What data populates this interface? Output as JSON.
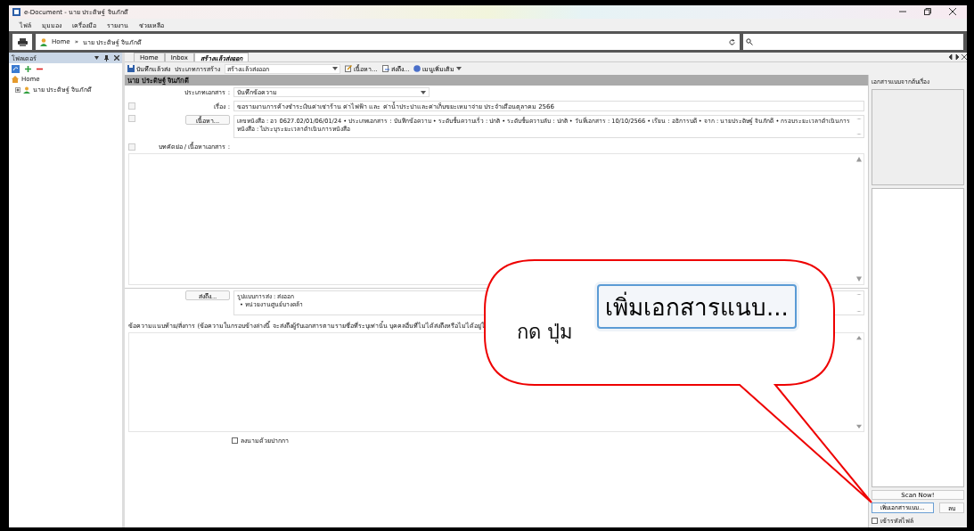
{
  "window": {
    "title": "e-Document - นาย ประดิษฐ์ จินภักดี"
  },
  "menu": [
    "ไฟล์",
    "มุมมอง",
    "เครื่องมือ",
    "รายงาน",
    "ช่วยเหลือ"
  ],
  "address": {
    "crumbs": [
      "Home",
      "»",
      "นาย ประดิษฐ์ จินภักดี"
    ]
  },
  "folder_panel": {
    "title": "โฟลเดอร์",
    "tree": [
      {
        "label": "Home",
        "children": [
          {
            "label": "นาย ประดิษฐ์ จินภักดี",
            "expanded": false
          }
        ]
      }
    ]
  },
  "tabs": [
    {
      "label": "Home",
      "selected": false
    },
    {
      "label": "Inbox",
      "selected": false
    },
    {
      "label": "สร้างแล้วส่งออก",
      "selected": true
    }
  ],
  "toolbar": {
    "save": "บันทึกแล้วส่ง",
    "create_type_label": "ประเภทการสร้าง",
    "create_type_value": "สร้างแล้วส่งออก",
    "content": "เนื้อหา...",
    "send_to": "ส่งถึง...",
    "more": "เมนูเพิ่มเติม"
  },
  "header": "นาย ประดิษฐ์ จินภักดี",
  "form": {
    "doc_type_label": "ประเภทเอกสาร :",
    "doc_type_value": "บันทึกข้อความ",
    "subject_label": "เรื่อง :",
    "subject_value": "ขอรายงานการค้างชำระเงินค่าเช่าร้าน ค่าไฟฟ้า และ ค่าน้ำประปาและค่าเก็บขยะเหมาจ่าย ประจำเดือนตุลาคม 2566",
    "content_button": "เนื้อหา...",
    "content_value": "เลขหนังสือ : อว 0627.02/01/06/01/24 • ประเภทเอกสาร : บันทึกข้อความ • ระดับชั้นความเร็ว : ปกติ • ระดับชั้นความลับ : ปกติ • วันที่เอกสาร : 10/10/2566 • เรียน : อธิการบดี • จาก : นายประดิษฐ์  จินภักดี • กรอบระยะเวลาดำเนินการหนังสือ : ไม่ระบุระยะเวลาดำเนินการหนังสือ",
    "abstract_label": "บทคัดย่อ / เนื้อหาเอกสาร :",
    "send_button": "ส่งถึง...",
    "send_lines": [
      "รูปแบบการส่ง : ส่งออก",
      "• หน่วยงานศูนย์บางคล้า"
    ],
    "note_label": "ข้อความแนบท้าย/สั่งการ (ข้อความในกรอบข้างล่างนี้ จะส่งถึงผู้รับเอกสารตามรายชื่อที่ระบุเท่านั้น บุคคลอื่นที่ไม่ได้ส่งถึงหรือไม่ได้อยู่ใ",
    "pen_sign": {
      "label": "ลงนามด้วยปากกา",
      "checked": false
    }
  },
  "attachments": {
    "title": "เอกสารแนบจากต้นเรื่อง",
    "scan": "Scan Now!",
    "add": "เพิ่มเอกสารแนบ...",
    "delete": "ลบ",
    "encrypt": {
      "label": "เข้ารหัสไฟล์",
      "checked": false
    }
  },
  "callout": {
    "text": "กด ปุ่ม",
    "button": "เพิ่มเอกสารแนบ..."
  }
}
